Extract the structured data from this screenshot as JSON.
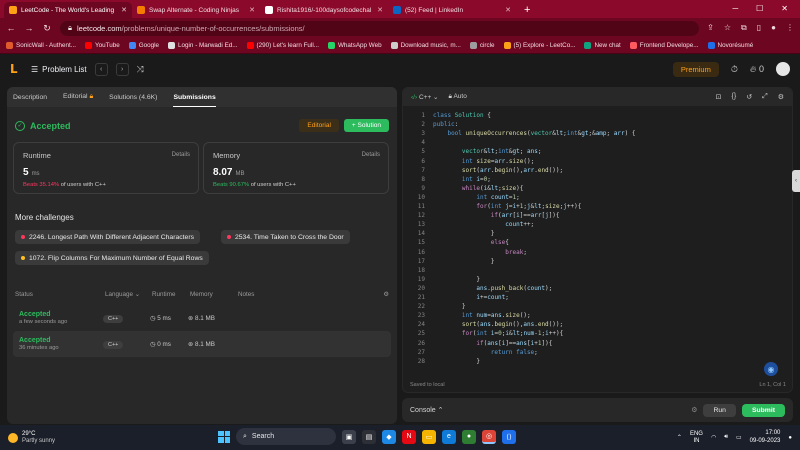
{
  "browser": {
    "tabs": [
      {
        "title": "LeetCode - The World's Leading",
        "color": "#ffa116",
        "active": true
      },
      {
        "title": "Swap Alternate - Coding Ninjas",
        "color": "#f57c00",
        "active": false
      },
      {
        "title": "Rishita1916/-100daysofcodechal",
        "color": "#ffffff",
        "active": false
      },
      {
        "title": "(52) Feed | LinkedIn",
        "color": "#0a66c2",
        "active": false
      }
    ],
    "new_tab": "+",
    "url_host": "leetcode.com",
    "url_path": "/problems/unique-number-of-occurrences/submissions/",
    "bookmarks": [
      {
        "label": "SonicWall - Authent...",
        "color": "#e05a2b"
      },
      {
        "label": "YouTube",
        "color": "#ff0000"
      },
      {
        "label": "Google",
        "color": "#4285f4"
      },
      {
        "label": "Login - Marwadi Ed...",
        "color": "#e0e0e0"
      },
      {
        "label": "(290) Let's learn Full...",
        "color": "#ff0000"
      },
      {
        "label": "WhatsApp Web",
        "color": "#25d366"
      },
      {
        "label": "Download music, m...",
        "color": "#cccccc"
      },
      {
        "label": "circle",
        "color": "#9e9e9e"
      },
      {
        "label": "(5) Explore - LeetCo...",
        "color": "#ffa116"
      },
      {
        "label": "New chat",
        "color": "#10a37f"
      },
      {
        "label": "Frontend Develope...",
        "color": "#ff5a5f"
      },
      {
        "label": "Novorésumé",
        "color": "#1f6feb"
      }
    ]
  },
  "header": {
    "problem_list": "Problem List",
    "premium": "Premium",
    "streak": "0"
  },
  "left": {
    "tabs": [
      "Description",
      "Editorial",
      "Solutions (4.6K)",
      "Submissions"
    ],
    "status": "Accepted",
    "editorial_btn": "Editorial",
    "solution_btn": "+ Solution",
    "runtime": {
      "label": "Runtime",
      "details": "Details",
      "value": "5",
      "unit": "ms",
      "beats_pct": "Beats 35.14%",
      "beats_rest": " of users with C++"
    },
    "memory": {
      "label": "Memory",
      "details": "Details",
      "value": "8.07",
      "unit": "MB",
      "beats_pct": "Beats 90.67%",
      "beats_rest": " of users with C++"
    },
    "more_title": "More challenges",
    "challenges": [
      {
        "label": "2246. Longest Path With Different Adjacent Characters",
        "color": "#ff375f"
      },
      {
        "label": "2534. Time Taken to Cross the Door",
        "color": "#ff375f"
      },
      {
        "label": "1072. Flip Columns For Maximum Number of Equal Rows",
        "color": "#ffc01e"
      }
    ],
    "table_headers": [
      "Status",
      "Language",
      "Runtime",
      "Memory",
      "Notes"
    ],
    "submissions": [
      {
        "status": "Accepted",
        "when": "a few seconds ago",
        "lang": "C++",
        "runtime": "5 ms",
        "memory": "8.1 MB"
      },
      {
        "status": "Accepted",
        "when": "36 minutes ago",
        "lang": "C++",
        "runtime": "0 ms",
        "memory": "8.1 MB"
      }
    ]
  },
  "editor": {
    "language": "C++",
    "auto": "Auto",
    "saved": "Saved to local",
    "position": "Ln 1, Col 1",
    "lines": [
      "class Solution {",
      "public:",
      "    bool uniqueOccurrences(vector<int>& arr) {",
      "",
      "        vector<int> ans;",
      "        int size=arr.size();",
      "        sort(arr.begin(),arr.end());",
      "        int i=0;",
      "        while(i<size){",
      "            int count=1;",
      "            for(int j=i+1;j<size;j++){",
      "                if(arr[i]==arr[j]){",
      "                    count++;",
      "                }",
      "                else{",
      "                    break;",
      "                }",
      "",
      "            }",
      "            ans.push_back(count);",
      "            i+=count;",
      "        }",
      "        int num=ans.size();",
      "        sort(ans.begin(),ans.end());",
      "        for(int i=0;i<num-1;i++){",
      "            if(ans[i]==ans[i+1]){",
      "                return false;",
      "            }"
    ]
  },
  "console": {
    "label": "Console",
    "run": "Run",
    "submit": "Submit"
  },
  "taskbar": {
    "temp": "29°C",
    "weather": "Partly sunny",
    "search": "Search",
    "lang1": "ENG",
    "lang2": "IN",
    "time": "17:00",
    "date": "09-09-2023"
  }
}
